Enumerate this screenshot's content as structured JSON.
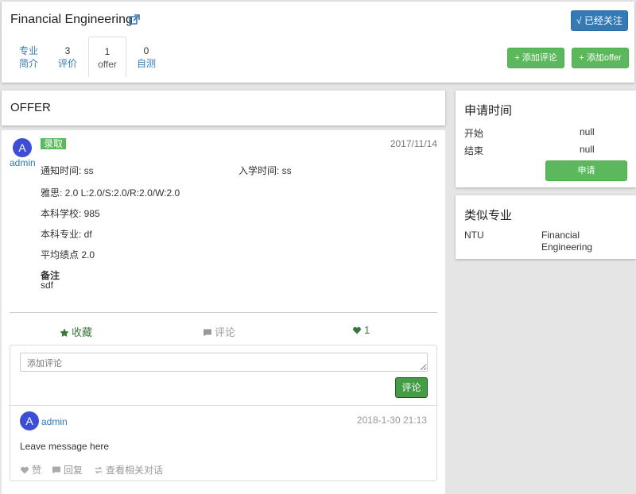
{
  "header": {
    "title": "Financial Engineering",
    "follow_label": "√ 已经关注",
    "tabs": [
      {
        "num": "",
        "label_line1": "专业",
        "label_line2": "简介"
      },
      {
        "num": "3",
        "label": "评价"
      },
      {
        "num": "1",
        "label": "offer"
      },
      {
        "num": "0",
        "label": "自测"
      }
    ],
    "add_review_label": "+ 添加评论",
    "add_offer_label": "+ 添加offer"
  },
  "offer_section": {
    "title": "OFFER",
    "avatar_letter": "A",
    "user": "admin",
    "status_badge": "录取",
    "date": "2017/11/14",
    "notice_time": "通知时间: ss",
    "enroll_time": "入学时间: ss",
    "ielts": "雅思:   2.0 L:2.0/S:2.0/R:2.0/W:2.0",
    "undergrad_school": "本科学校: 985",
    "undergrad_major": "本科专业: df",
    "gpa": "平均绩点 2.0",
    "notes_label": "备注",
    "notes_value": "sdf",
    "actions": {
      "favorite": "收藏",
      "comment": "评论",
      "like_count": "1"
    },
    "comment_form": {
      "placeholder": "添加评论",
      "submit_label": "评论"
    },
    "comment": {
      "avatar_letter": "A",
      "user": "admin",
      "time": "2018-1-30 21:13",
      "text": "Leave message here",
      "like_label": "赞",
      "reply_label": "回复",
      "thread_label": "查看相关对话"
    }
  },
  "sidebar": {
    "apply_time": {
      "title": "申请时间",
      "start_label": "开始",
      "start_value": "null",
      "end_label": "结束",
      "end_value": "null",
      "apply_button": "申请"
    },
    "similar": {
      "title": "类似专业",
      "school": "NTU",
      "major_line1": "Financial",
      "major_line2": "Engineering"
    }
  },
  "colors": {
    "primary": "#337ab7",
    "success": "#5cb85c",
    "avatar": "#3d4dd6",
    "background": "#e5e5e5"
  }
}
